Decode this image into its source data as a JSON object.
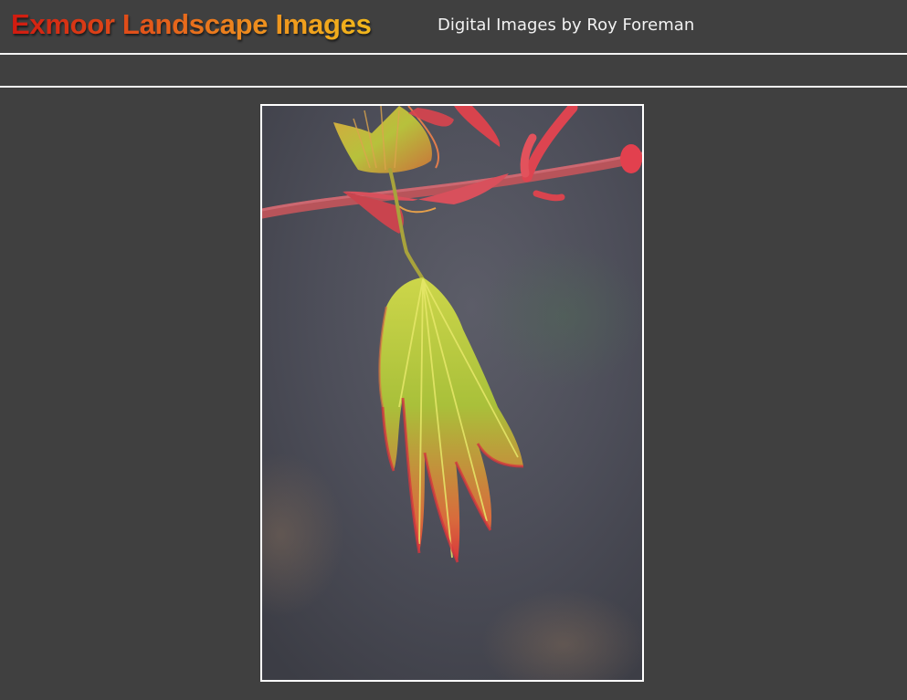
{
  "header": {
    "title": "Exmoor Landscape Images",
    "subtitle": "Digital Images by Roy Foreman"
  },
  "photo": {
    "subject": "maple-leaf-photo",
    "accent_colors": {
      "leaf_green": "#b9c63a",
      "leaf_red": "#d9343c",
      "background": "#4c4d58"
    }
  },
  "colors": {
    "page_background": "#404040",
    "rule": "#f4f4f4",
    "title_start": "#d01a10",
    "title_end": "#f2b81c",
    "subtitle": "#f2f2f2"
  }
}
